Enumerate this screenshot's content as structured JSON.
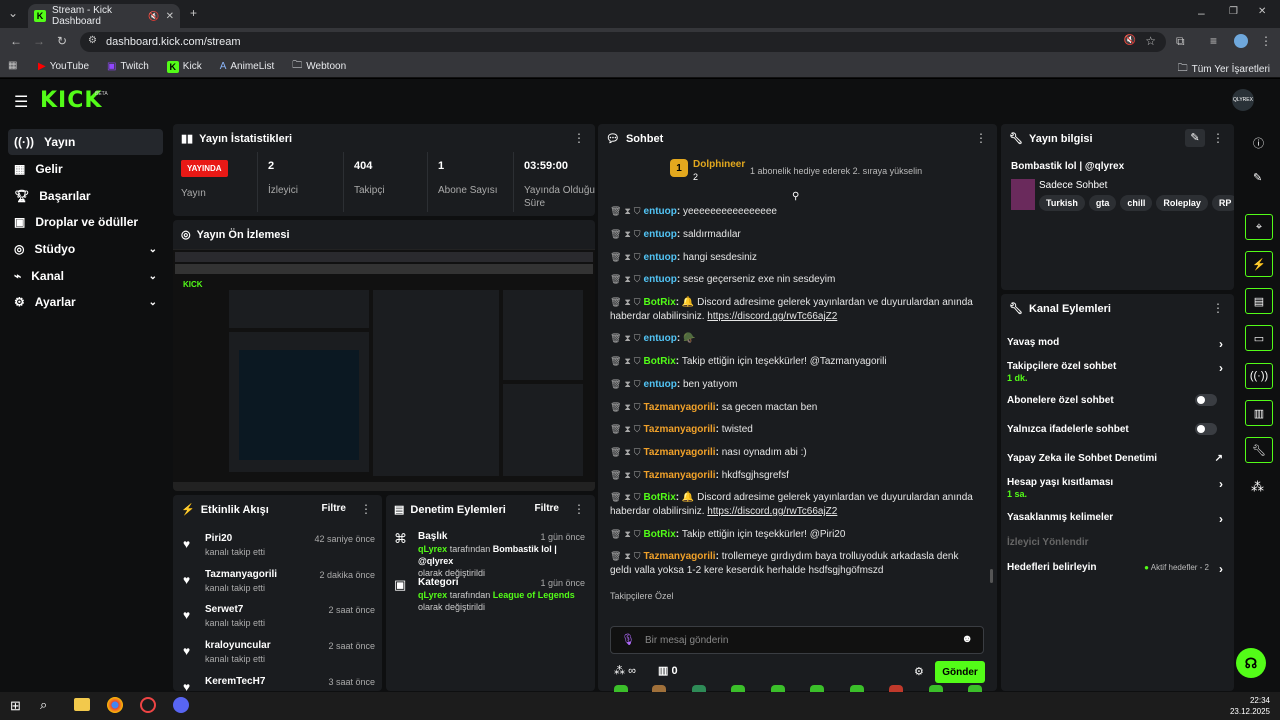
{
  "browser": {
    "tab_title": "Stream - Kick Dashboard",
    "url": "dashboard.kick.com/stream",
    "bookmarks": [
      "YouTube",
      "Twitch",
      "Kick",
      "AnimeList",
      "Webtoon"
    ],
    "all_bookmarks": "Tüm Yer İşaretleri"
  },
  "app": {
    "logo": "KICK",
    "beta": "BETA",
    "avatar": "QLYREX"
  },
  "sidebar": {
    "items": [
      {
        "label": "Yayın",
        "icon": "broadcast-icon"
      },
      {
        "label": "Gelir",
        "icon": "revenue-icon"
      },
      {
        "label": "Başarılar",
        "icon": "trophy-icon"
      },
      {
        "label": "Droplar ve ödüller",
        "icon": "gift-icon"
      },
      {
        "label": "Stüdyo",
        "icon": "studio-icon"
      },
      {
        "label": "Kanal",
        "icon": "channel-icon"
      },
      {
        "label": "Ayarlar",
        "icon": "gear-icon"
      }
    ]
  },
  "stats": {
    "title": "Yayın İstatistikleri",
    "live_badge": "YAYINDA",
    "live_label": "Yayın",
    "items": [
      {
        "value": "2",
        "label": "İzleyici"
      },
      {
        "value": "404",
        "label": "Takipçi"
      },
      {
        "value": "1",
        "label": "Abone Sayısı"
      },
      {
        "value": "03:59:00",
        "label": "Yayında Olduğu Süre"
      }
    ]
  },
  "preview": {
    "title": "Yayın Ön İzlemesi"
  },
  "activity": {
    "title": "Etkinlik Akışı",
    "filter": "Filtre",
    "items": [
      {
        "name": "Piri20",
        "sub": "kanalı takip etti",
        "time": "42 saniye önce"
      },
      {
        "name": "Tazmanyagorili",
        "sub": "kanalı takip etti",
        "time": "2 dakika önce"
      },
      {
        "name": "Serwet7",
        "sub": "kanalı takip etti",
        "time": "2 saat önce"
      },
      {
        "name": "kraloyuncular",
        "sub": "kanalı takip etti",
        "time": "2 saat önce"
      },
      {
        "name": "KeremTecH7",
        "sub": "",
        "time": "3 saat önce"
      }
    ]
  },
  "moderation": {
    "title": "Denetim Eylemleri",
    "filter": "Filtre",
    "items": [
      {
        "heading": "Başlık",
        "time": "1 gün önce",
        "user": "qLyrex",
        "by": "tarafından",
        "value": "Bombastik lol | @qlyrex",
        "suffix": "olarak değiştirildi"
      },
      {
        "heading": "Kategori",
        "time": "1 gün önce",
        "user": "qLyrex",
        "by": "tarafından",
        "value": "League of Legends",
        "suffix": "olarak değiştirildi"
      }
    ]
  },
  "chat": {
    "title": "Sohbet",
    "top_gifter": "Dolphineer",
    "top_gifter_rank": "1",
    "top_gifter_count": "2",
    "gift_note": "1 abonelik hediye ederek 2. sıraya yükselin",
    "messages": [
      {
        "user": "entuop",
        "cls": "un-b",
        "text": "yeeeeeeeeeeeeeeee"
      },
      {
        "user": "entuop",
        "cls": "un-b",
        "text": "saldırmadılar"
      },
      {
        "user": "entuop",
        "cls": "un-b",
        "text": "hangi sesdesiniz"
      },
      {
        "user": "entuop",
        "cls": "un-b",
        "text": "sese geçerseniz exe nin sesdeyim"
      },
      {
        "user": "BotRix",
        "cls": "un-g",
        "text": "🔔 Discord adresime gelerek yayınlardan ve duyurulardan anında haberdar olabilirsiniz.",
        "link": "https://discord.gg/rwTc66ajZ2"
      },
      {
        "user": "entuop",
        "cls": "un-b",
        "text": "🪖"
      },
      {
        "user": "BotRix",
        "cls": "un-g",
        "text": "Takip ettiğin için teşekkürler! @Tazmanyagorili"
      },
      {
        "user": "entuop",
        "cls": "un-b",
        "text": "ben yatıyom"
      },
      {
        "user": "Tazmanyagorili",
        "cls": "un-o",
        "text": "sa gecen mactan ben"
      },
      {
        "user": "Tazmanyagorili",
        "cls": "un-o",
        "text": "twisted"
      },
      {
        "user": "Tazmanyagorili",
        "cls": "un-o",
        "text": "nası oynadım abi :)"
      },
      {
        "user": "Tazmanyagorili",
        "cls": "un-o",
        "text": "hkdfsgjhsgrefsf"
      },
      {
        "user": "BotRix",
        "cls": "un-g",
        "text": "🔔 Discord adresime gelerek yayınlardan ve duyurulardan anında haberdar olabilirsiniz.",
        "link": "https://discord.gg/rwTc66ajZ2"
      },
      {
        "user": "BotRix",
        "cls": "un-g",
        "text": "Takip ettiğin için teşekkürler! @Piri20"
      },
      {
        "user": "Tazmanyagorili",
        "cls": "un-o",
        "text": "trollemeye gırdıydım baya trolluyoduk arkadasla denk geldı valla yoksa 1-2 kere keserdık herhalde hsdfsgjhgöfmszd"
      }
    ],
    "followers_only": "Takipçilere Özel",
    "placeholder": "Bir mesaj gönderin",
    "points": "∞",
    "count": "0",
    "send": "Gönder"
  },
  "info": {
    "title": "Yayın bilgisi",
    "stream_title": "Bombastik lol | @qlyrex",
    "category": "Sadece Sohbet",
    "tags": [
      "Turkish",
      "gta",
      "chill",
      "Roleplay",
      "RP"
    ]
  },
  "channel_actions": {
    "title": "Kanal Eylemleri",
    "items": [
      {
        "label": "Yavaş mod",
        "sub": "",
        "ctl": "arrow"
      },
      {
        "label": "Takipçilere özel sohbet",
        "sub": "1 dk.",
        "ctl": "arrow"
      },
      {
        "label": "Abonelere özel sohbet",
        "sub": "",
        "ctl": "toggle"
      },
      {
        "label": "Yalnızca ifadelerle sohbet",
        "sub": "",
        "ctl": "toggle"
      },
      {
        "label": "Yapay Zeka ile Sohbet Denetimi",
        "sub": "",
        "ctl": "ext"
      },
      {
        "label": "Hesap yaşı kısıtlaması",
        "sub": "1 sa.",
        "ctl": "arrow"
      },
      {
        "label": "Yasaklanmış kelimeler",
        "sub": "",
        "ctl": "arrow"
      },
      {
        "label": "İzleyici Yönlendir",
        "sub": "",
        "ctl": "none"
      },
      {
        "label": "Hedefleri belirleyin",
        "sub": "",
        "ctl": "arrow"
      }
    ],
    "goals_status": "Aktif hedefler - 2"
  },
  "taskbar": {
    "time": "22:34",
    "date": "23.12.2025"
  }
}
